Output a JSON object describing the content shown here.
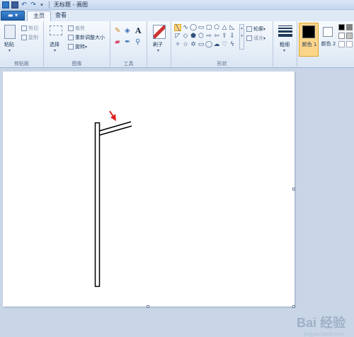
{
  "window": {
    "title": "无标题 - 画图"
  },
  "tabs": [
    {
      "label": "主页",
      "active": true
    },
    {
      "label": "查看",
      "active": false
    }
  ],
  "ribbon": {
    "clipboard": {
      "group_label": "剪贴板",
      "paste_label": "粘贴",
      "cut_label": "剪切",
      "copy_label": "复制"
    },
    "image": {
      "group_label": "图像",
      "select_label": "选择",
      "crop_label": "裁剪",
      "resize_label": "重新调整大小",
      "rotate_label": "旋转"
    },
    "tools": {
      "group_label": "工具"
    },
    "brushes": {
      "label": "刷子"
    },
    "shapes": {
      "group_label": "形状",
      "outline_label": "轮廓",
      "fill_label": "填充"
    },
    "size": {
      "label": "粗细"
    },
    "colors": {
      "color1_label": "颜色 1",
      "color2_label": "颜色 2",
      "color1_value": "#000000",
      "color2_value": "#ffffff"
    }
  },
  "watermark": {
    "text": "Bai 经验",
    "subtext": "jingyan.baidu.com"
  },
  "drawing": {
    "stroke_color": "#000000",
    "arrow_color": "#e02020"
  }
}
